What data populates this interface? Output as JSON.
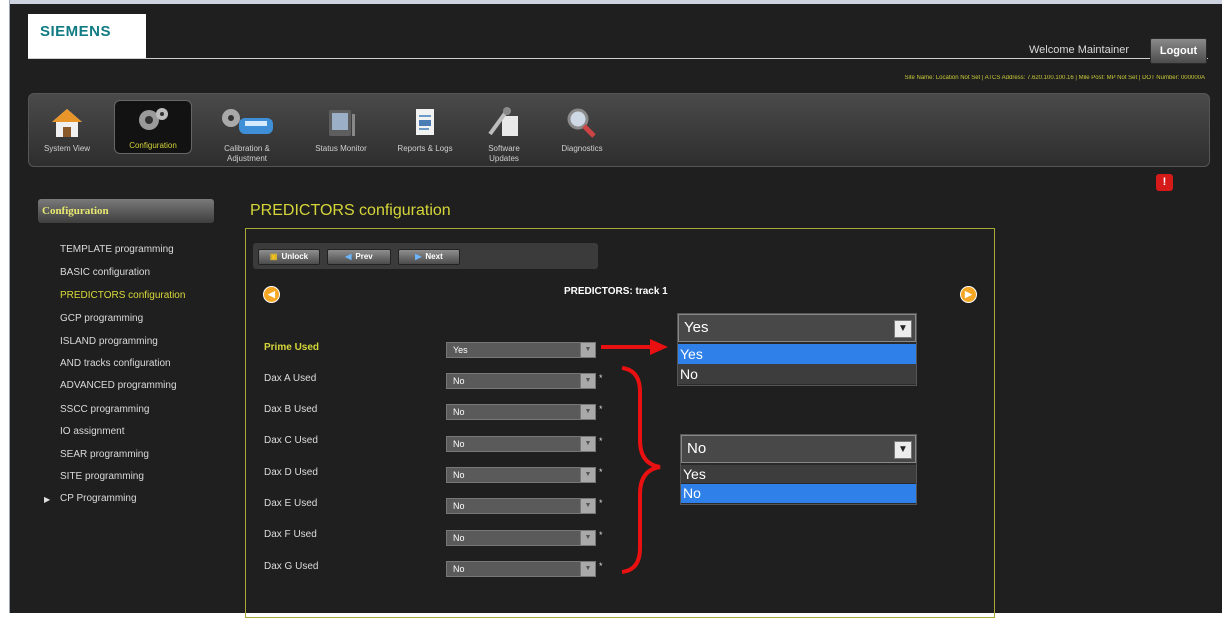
{
  "brand": {
    "logo_text": "SIEMENS"
  },
  "header": {
    "welcome": "Welcome Maintainer",
    "logout_label": "Logout",
    "site_info": "Site Name: Location Not Set | ATCS Address: 7.620.100.100.16 | Mile Post: MP Not Set | DOT Number: 000000A"
  },
  "toolbar": {
    "items": [
      {
        "label": "System View",
        "icon": "house-icon"
      },
      {
        "label": "Configuration",
        "icon": "gears-icon",
        "active": true
      },
      {
        "label": "Calibration & Adjustment",
        "icon": "train-icon"
      },
      {
        "label": "Status Monitor",
        "icon": "monitor-icon"
      },
      {
        "label": "Reports & Logs",
        "icon": "report-icon"
      },
      {
        "label": "Software Updates",
        "icon": "tools-icon"
      },
      {
        "label": "Diagnostics",
        "icon": "magnifier-icon"
      }
    ]
  },
  "alert": {
    "glyph": "!"
  },
  "sidebar": {
    "header": "Configuration",
    "items": [
      {
        "label": "TEMPLATE programming"
      },
      {
        "label": "BASIC configuration"
      },
      {
        "label": "PREDICTORS configuration",
        "active": true
      },
      {
        "label": "GCP programming"
      },
      {
        "label": "ISLAND programming"
      },
      {
        "label": "AND tracks configuration"
      },
      {
        "label": "ADVANCED programming"
      },
      {
        "label": "SSCC programming"
      },
      {
        "label": "IO assignment"
      },
      {
        "label": "SEAR programming"
      },
      {
        "label": "SITE programming"
      },
      {
        "label": "CP Programming",
        "expandable": true
      }
    ]
  },
  "main": {
    "title": "PREDICTORS configuration",
    "buttons": {
      "unlock": "Unlock",
      "prev": "Prev",
      "next": "Next"
    },
    "track_title": "PREDICTORS: track 1",
    "rows": [
      {
        "label": "Prime Used",
        "value": "Yes",
        "required": false
      },
      {
        "label": "Dax A Used",
        "value": "No",
        "required": true
      },
      {
        "label": "Dax B Used",
        "value": "No",
        "required": true
      },
      {
        "label": "Dax C Used",
        "value": "No",
        "required": true
      },
      {
        "label": "Dax D Used",
        "value": "No",
        "required": true
      },
      {
        "label": "Dax E Used",
        "value": "No",
        "required": true
      },
      {
        "label": "Dax F Used",
        "value": "No",
        "required": true
      },
      {
        "label": "Dax G Used",
        "value": "No",
        "required": true
      }
    ],
    "required_marker": "*"
  },
  "callouts": {
    "prime": {
      "selected": "Yes",
      "options": [
        "Yes",
        "No"
      ],
      "highlighted": "Yes"
    },
    "dax": {
      "selected": "No",
      "options": [
        "Yes",
        "No"
      ],
      "highlighted": "No"
    }
  },
  "annotation_colors": {
    "arrow": "#e81010",
    "brace": "#e81010"
  }
}
